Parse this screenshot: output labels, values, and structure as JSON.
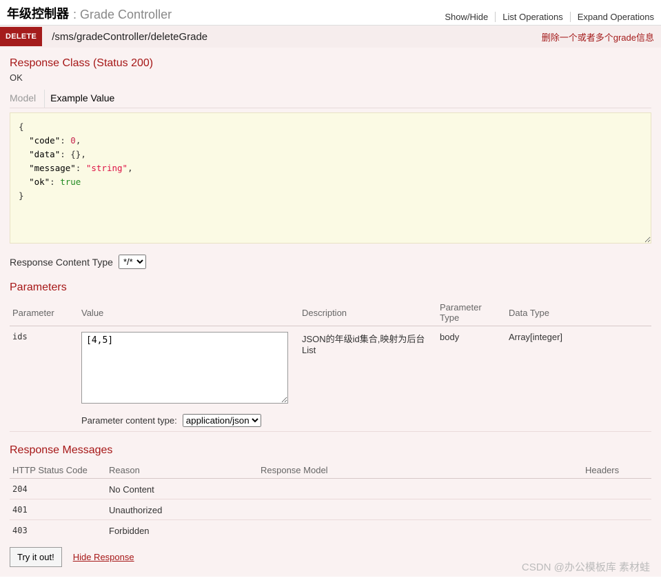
{
  "header": {
    "title_cn": "年级控制器",
    "separator": " : ",
    "subtitle": "Grade Controller",
    "ops": {
      "show_hide": "Show/Hide",
      "list": "List Operations",
      "expand": "Expand Operations"
    }
  },
  "endpoint": {
    "method": "DELETE",
    "path": "/sms/gradeController/deleteGrade",
    "desc": "删除一个或者多个grade信息"
  },
  "response_class": {
    "title": "Response Class (Status 200)",
    "ok": "OK",
    "tabs": {
      "model": "Model",
      "example": "Example Value"
    },
    "example_json": {
      "brace_open": "{",
      "line1_key": "\"code\"",
      "line1_val": "0",
      "line2_key": "\"data\"",
      "line2_val": "{}",
      "line3_key": "\"message\"",
      "line3_val": "\"string\"",
      "line4_key": "\"ok\"",
      "line4_val": "true",
      "brace_close": "}"
    },
    "content_type_label": "Response Content Type",
    "content_type_value": "*/*"
  },
  "parameters": {
    "title": "Parameters",
    "headers": {
      "param": "Parameter",
      "value": "Value",
      "desc": "Description",
      "ptype": "Parameter Type",
      "dtype": "Data Type"
    },
    "rows": [
      {
        "name": "ids",
        "value": "[4,5]",
        "desc": "JSON的年级id集合,映射为后台List",
        "ptype": "body",
        "dtype": "Array[integer]"
      }
    ],
    "pct_label": "Parameter content type:",
    "pct_value": "application/json"
  },
  "response_messages": {
    "title": "Response Messages",
    "headers": {
      "code": "HTTP Status Code",
      "reason": "Reason",
      "model": "Response Model",
      "hdrs": "Headers"
    },
    "rows": [
      {
        "code": "204",
        "reason": "No Content"
      },
      {
        "code": "401",
        "reason": "Unauthorized"
      },
      {
        "code": "403",
        "reason": "Forbidden"
      }
    ]
  },
  "actions": {
    "try": "Try it out!",
    "hide": "Hide Response"
  },
  "watermark": "CSDN @办公模板库 素材蛙"
}
